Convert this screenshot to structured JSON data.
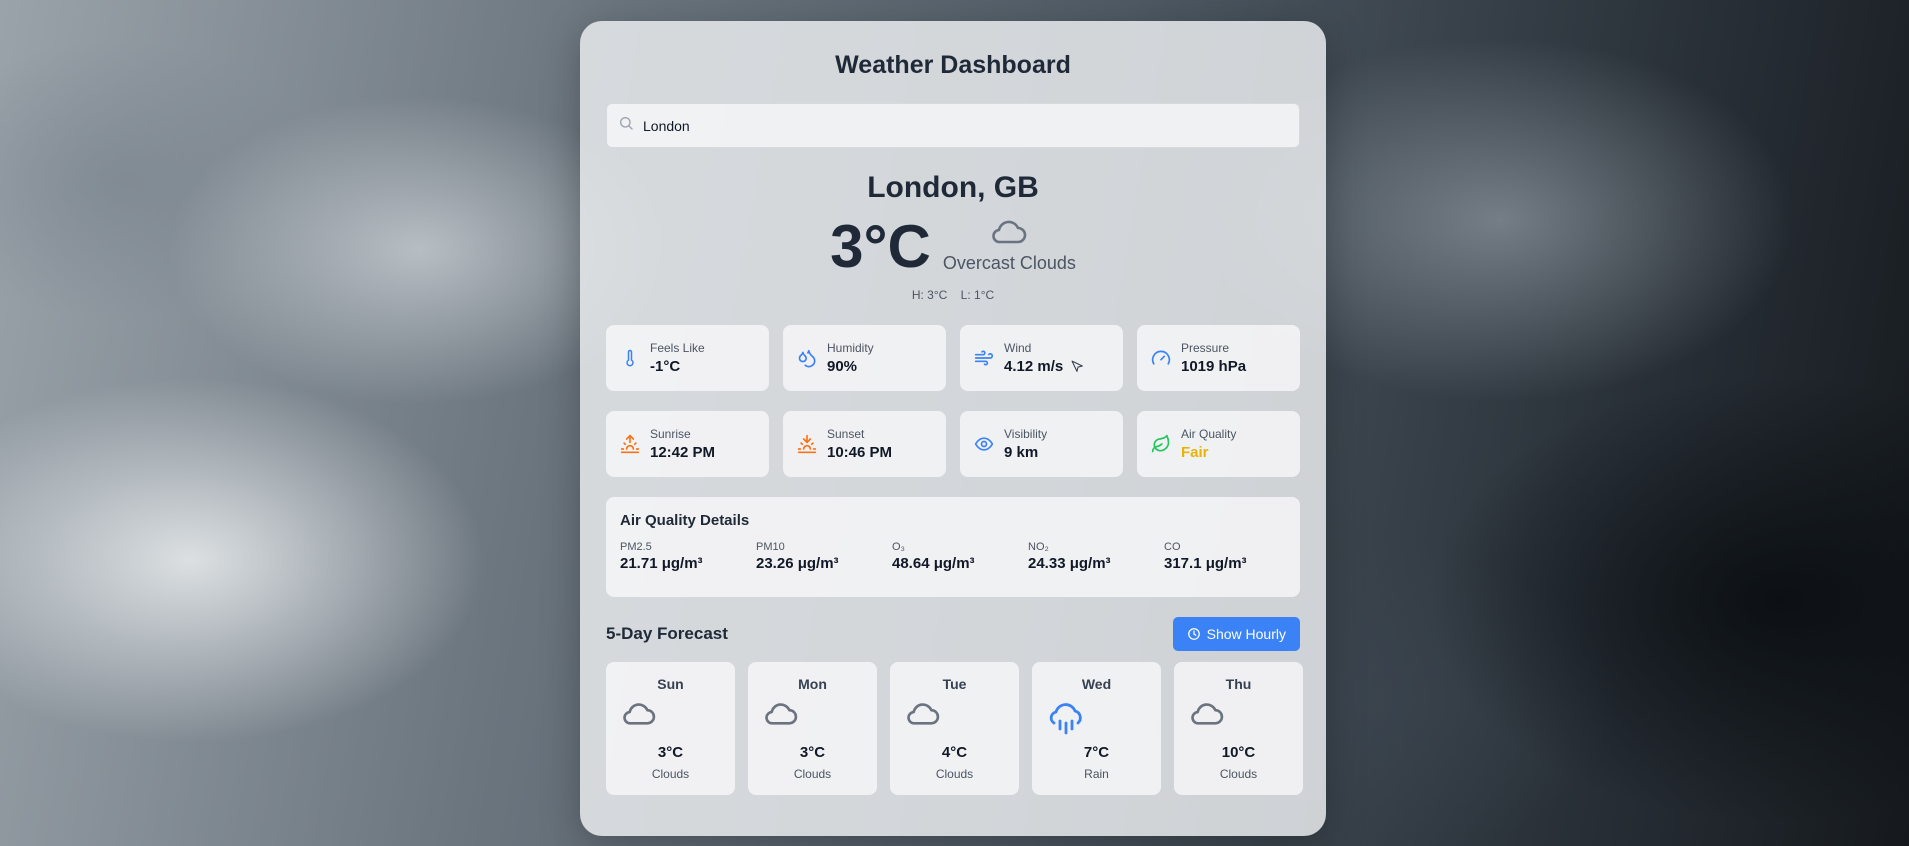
{
  "app": {
    "title": "Weather Dashboard"
  },
  "search": {
    "value": "London",
    "icon": "search-icon"
  },
  "current": {
    "location": "London, GB",
    "temperature": "3°C",
    "condition": "Overcast Clouds",
    "condition_icon": "cloud-icon",
    "high": "H: 3°C",
    "low": "L: 1°C"
  },
  "stats": [
    {
      "label": "Feels Like",
      "value": "-1°C",
      "icon": "thermometer-icon"
    },
    {
      "label": "Humidity",
      "value": "90%",
      "icon": "droplets-icon"
    },
    {
      "label": "Wind",
      "value": "4.12 m/s",
      "icon": "wind-icon"
    },
    {
      "label": "Pressure",
      "value": "1019 hPa",
      "icon": "gauge-icon"
    },
    {
      "label": "Sunrise",
      "value": "12:42 PM",
      "icon": "sunrise-icon"
    },
    {
      "label": "Sunset",
      "value": "10:46 PM",
      "icon": "sunset-icon"
    },
    {
      "label": "Visibility",
      "value": "9 km",
      "icon": "eye-icon"
    },
    {
      "label": "Air Quality",
      "value": "Fair",
      "icon": "leaf-icon"
    }
  ],
  "air_quality": {
    "title": "Air Quality Details",
    "items": [
      {
        "label": "PM2.5",
        "value": "21.71 μg/m³"
      },
      {
        "label": "PM10",
        "value": "23.26 μg/m³"
      },
      {
        "label": "O₃",
        "value": "48.64 μg/m³"
      },
      {
        "label": "NO₂",
        "value": "24.33 μg/m³"
      },
      {
        "label": "CO",
        "value": "317.1 μg/m³"
      }
    ]
  },
  "forecast": {
    "title": "5-Day Forecast",
    "toggle_label": "Show Hourly",
    "days": [
      {
        "day": "Sun",
        "temp": "3°C",
        "desc": "Clouds",
        "icon": "cloud-icon"
      },
      {
        "day": "Mon",
        "temp": "3°C",
        "desc": "Clouds",
        "icon": "cloud-icon"
      },
      {
        "day": "Tue",
        "temp": "4°C",
        "desc": "Clouds",
        "icon": "cloud-icon"
      },
      {
        "day": "Wed",
        "temp": "7°C",
        "desc": "Rain",
        "icon": "cloud-rain-icon"
      },
      {
        "day": "Thu",
        "temp": "10°C",
        "desc": "Clouds",
        "icon": "cloud-icon"
      }
    ]
  },
  "colors": {
    "accent": "#3b82f6",
    "sun_orange": "#f97316",
    "aqi_fair": "#eab308",
    "leaf_green": "#22c55e"
  }
}
